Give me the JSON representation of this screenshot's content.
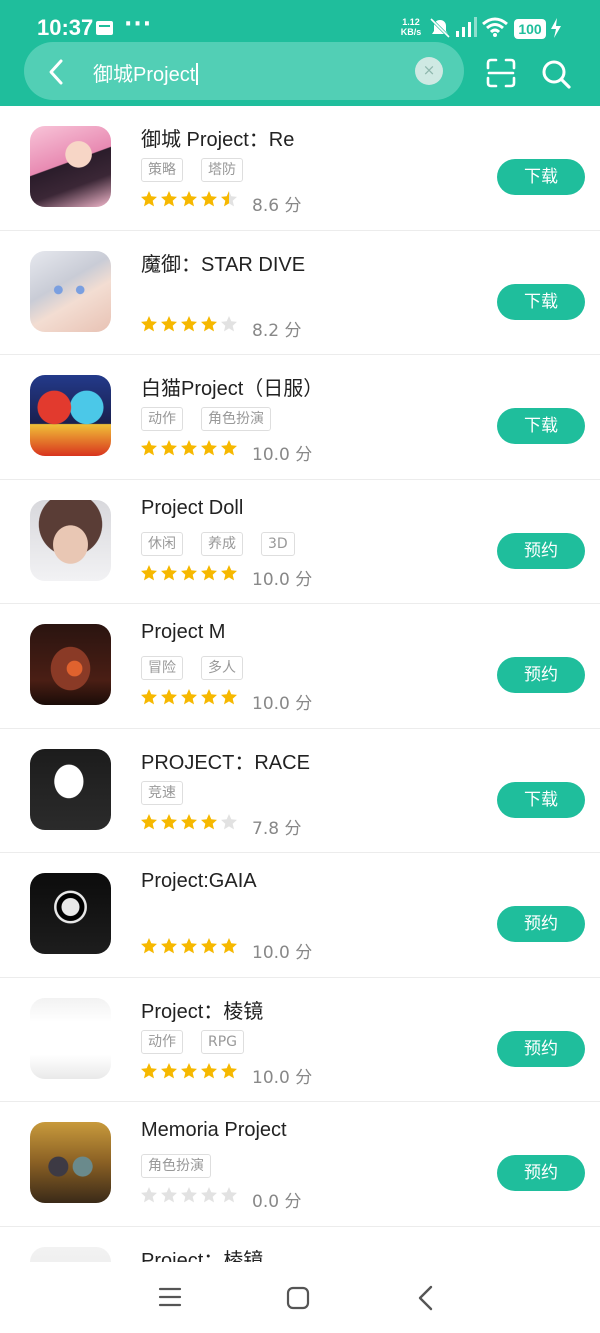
{
  "status_bar": {
    "time": "10:37",
    "dots": "···",
    "speed_value": "1.12",
    "speed_unit": "KB/s",
    "battery": "100",
    "icons": [
      "notification-icon",
      "mute-icon",
      "wifi-icon",
      "signal-icon",
      "charging-icon"
    ]
  },
  "search": {
    "query": "御城Project",
    "clear_label": "×",
    "icons": [
      "back-icon",
      "scan-icon",
      "search-icon"
    ]
  },
  "colors": {
    "accent": "#1fbe9c",
    "star_filled": "#f6b800",
    "star_empty": "#e2e2e2"
  },
  "results": [
    {
      "title": "御城 Project：Re",
      "tags": [
        "策略",
        "塔防"
      ],
      "rating": 4.5,
      "score": "8.6 分",
      "action": "下载"
    },
    {
      "title": "魔御：STAR DIVE",
      "tags": [],
      "rating": 4,
      "score": "8.2 分",
      "action": "下载"
    },
    {
      "title": "白猫Project（日服）",
      "tags": [
        "动作",
        "角色扮演"
      ],
      "rating": 5,
      "score": "10.0 分",
      "action": "下载"
    },
    {
      "title": "Project Doll",
      "tags": [
        "休闲",
        "养成",
        "3D"
      ],
      "rating": 5,
      "score": "10.0 分",
      "action": "预约"
    },
    {
      "title": "Project M",
      "tags": [
        "冒险",
        "多人"
      ],
      "rating": 5,
      "score": "10.0 分",
      "action": "预约"
    },
    {
      "title": "PROJECT：RACE",
      "tags": [
        "竞速"
      ],
      "rating": 4,
      "score": "7.8 分",
      "action": "下载"
    },
    {
      "title": "Project:GAIA",
      "tags": [],
      "rating": 5,
      "score": "10.0 分",
      "action": "预约"
    },
    {
      "title": "Project：棱镜",
      "tags": [
        "动作",
        "RPG"
      ],
      "rating": 5,
      "score": "10.0 分",
      "action": "预约"
    },
    {
      "title": "Memoria Project",
      "tags": [
        "角色扮演"
      ],
      "rating": 0,
      "score": "0.0 分",
      "action": "预约"
    },
    {
      "title": "Project：棱镜",
      "tags": [],
      "rating": 0,
      "score": "",
      "action": ""
    }
  ],
  "nav_bar": {
    "icons": [
      "menu-icon",
      "home-icon",
      "back-nav-icon"
    ]
  }
}
